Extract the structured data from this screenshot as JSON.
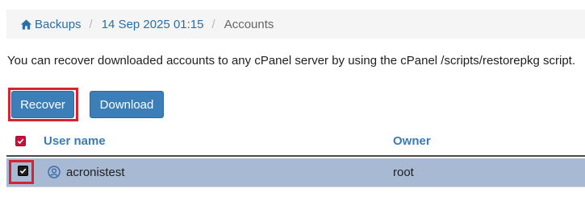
{
  "breadcrumb": {
    "items": [
      {
        "label": "Backups",
        "icon": "home-icon"
      },
      {
        "label": "14 Sep 2025 01:15"
      },
      {
        "label": "Accounts"
      }
    ]
  },
  "intro_text": "You can recover downloaded accounts to any cPanel server by using the cPanel /scripts/restorepkg script.",
  "actions": {
    "recover_label": "Recover",
    "download_label": "Download"
  },
  "table": {
    "columns": [
      "User name",
      "Owner"
    ],
    "select_all_checked": true,
    "rows": [
      {
        "user": "acronistest",
        "owner": "root",
        "checked": true,
        "icon": "user-icon"
      }
    ]
  },
  "colors": {
    "accent": "#3c7fb8",
    "link": "#2a6fa8",
    "highlight": "#d72230",
    "selected_row": "#a8b9d3"
  }
}
